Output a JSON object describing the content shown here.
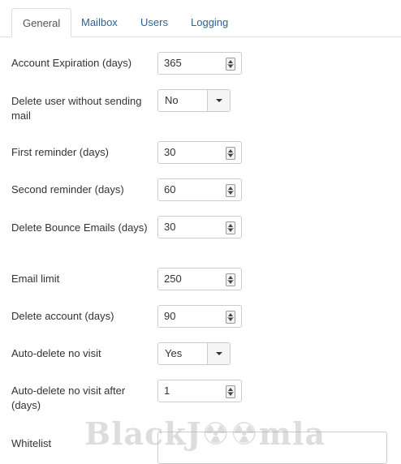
{
  "tabs": [
    {
      "label": "General",
      "active": true
    },
    {
      "label": "Mailbox",
      "active": false
    },
    {
      "label": "Users",
      "active": false
    },
    {
      "label": "Logging",
      "active": false
    }
  ],
  "fields": {
    "account_expiration": {
      "label": "Account Expiration (days)",
      "value": "365"
    },
    "delete_user_without_mail": {
      "label": "Delete user without sending mail",
      "value": "No"
    },
    "first_reminder": {
      "label": "First reminder (days)",
      "value": "30"
    },
    "second_reminder": {
      "label": "Second reminder (days)",
      "value": "60"
    },
    "delete_bounce_emails": {
      "label": "Delete Bounce Emails (days)",
      "value": "30"
    },
    "email_limit": {
      "label": "Email limit",
      "value": "250"
    },
    "delete_account": {
      "label": "Delete account (days)",
      "value": "90"
    },
    "auto_delete_no_visit": {
      "label": "Auto-delete no visit",
      "value": "Yes"
    },
    "auto_delete_no_visit_after": {
      "label": "Auto-delete no visit after (days)",
      "value": "1"
    },
    "whitelist": {
      "label": "Whitelist",
      "value": ""
    }
  },
  "watermark": "BlackJØØmla",
  "colors": {
    "tab_link": "#2a6496",
    "border": "#cccccc",
    "text": "#333333"
  }
}
